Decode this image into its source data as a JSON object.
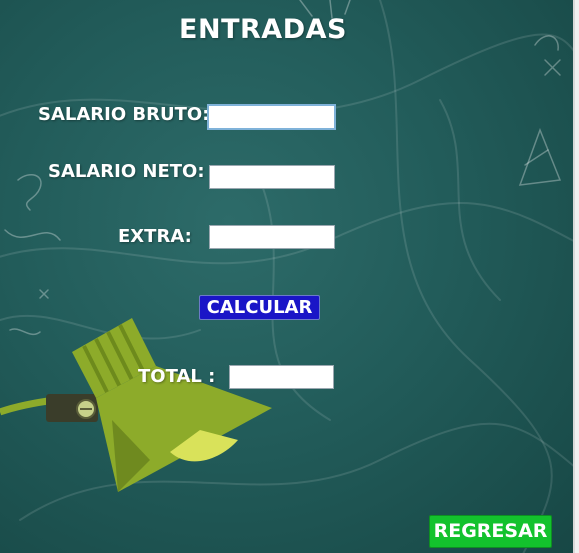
{
  "window": {
    "title": "ENTRADAS"
  },
  "form": {
    "gross_salary": {
      "label": "SALARIO BRUTO:",
      "value": ""
    },
    "net_salary": {
      "label": "SALARIO NETO:",
      "value": ""
    },
    "extra": {
      "label": "EXTRA:",
      "value": ""
    },
    "total": {
      "label": "TOTAL :",
      "value": ""
    }
  },
  "buttons": {
    "calculate": "CALCULAR",
    "back": "REGRESAR"
  },
  "colors": {
    "background": "#225c5a",
    "calculate_button": "#1a15c7",
    "back_button": "#13c22d",
    "lamp": "#8dab2a"
  }
}
